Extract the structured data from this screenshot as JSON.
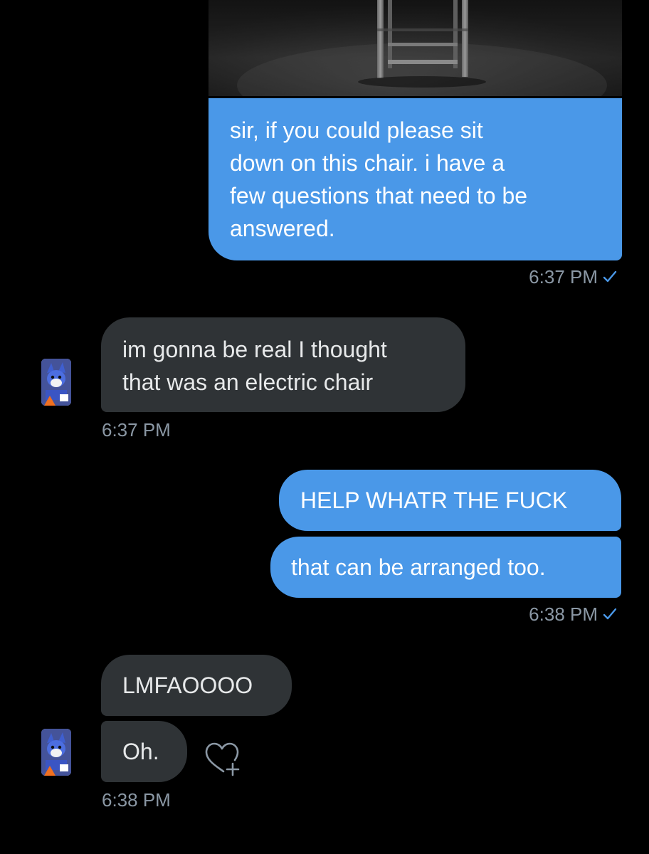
{
  "conversation": {
    "messages": [
      {
        "sender": "me",
        "text": "sir, if you could please sit down on this chair. i have a few questions that need to be answered.",
        "lines": [
          "sir, if you could please sit",
          "down on this chair. i have a",
          "few questions that need to be",
          "answered."
        ],
        "attachment_icon": "photo-of-chair",
        "time": "6:37 PM",
        "status_icon": "check-icon"
      },
      {
        "sender": "them",
        "text": "im gonna be real I thought that was an electric chair",
        "lines": [
          "im gonna be real I thought",
          "that was an electric chair"
        ],
        "time": "6:37 PM"
      },
      {
        "sender": "me",
        "text": "HELP WHATR THE FUCK"
      },
      {
        "sender": "me",
        "text": "that can be arranged too.",
        "time": "6:38 PM",
        "status_icon": "check-icon"
      },
      {
        "sender": "them",
        "text": "LMFAOOOO"
      },
      {
        "sender": "them",
        "text": "Oh.",
        "time": "6:38 PM",
        "action_icon": "add-reaction-icon"
      }
    ]
  },
  "colors": {
    "background": "#000000",
    "outgoing_bubble": "#4a98e8",
    "incoming_bubble": "#2f3336",
    "timestamp": "#8b98a5",
    "check": "#4a98e8"
  }
}
